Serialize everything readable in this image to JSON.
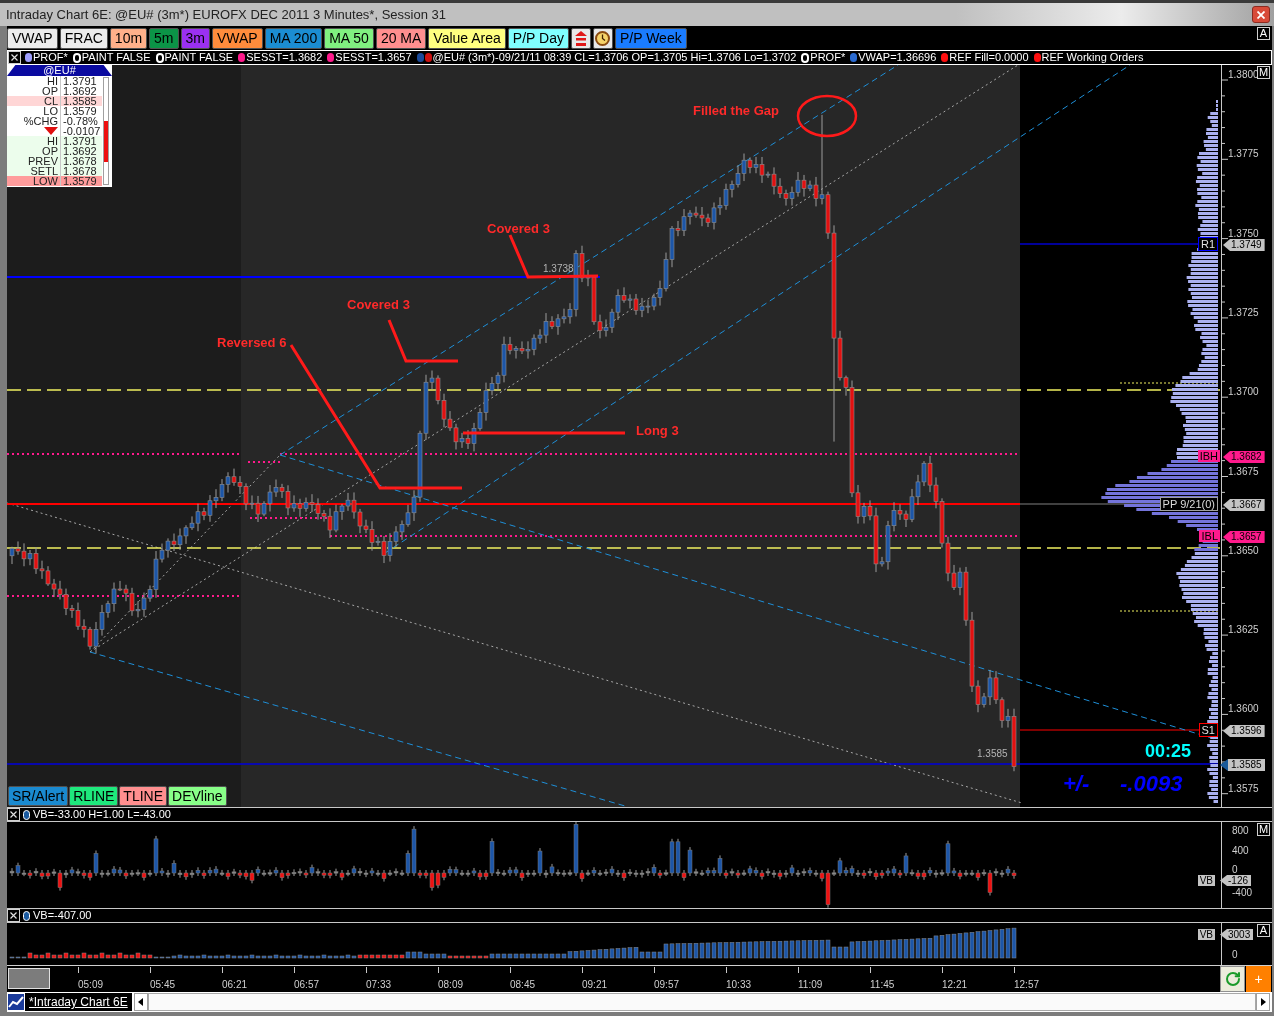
{
  "window": {
    "title": "Intraday Chart 6E: @EU# (3m*) EUROFX DEC 2011 3 Minutes*, Session 31"
  },
  "toolbar": {
    "buttons": [
      {
        "kind": "text",
        "label": "VWAP",
        "color": "#ececec"
      },
      {
        "kind": "text",
        "label": "FRAC",
        "color": "#ececec"
      },
      {
        "kind": "text",
        "label": "10m",
        "color": "#ffb08a"
      },
      {
        "kind": "text",
        "label": "5m",
        "color": "#0b9447"
      },
      {
        "kind": "text",
        "label": "3m",
        "color": "#9b30f2"
      },
      {
        "kind": "text",
        "label": "VWAP",
        "color": "#ff8c3c"
      },
      {
        "kind": "text",
        "label": "MA 200",
        "color": "#1b8dd2"
      },
      {
        "kind": "text",
        "label": "MA 50",
        "color": "#80f080"
      },
      {
        "kind": "text",
        "label": "20 MA",
        "color": "#ff8f8f"
      },
      {
        "kind": "text",
        "label": "Value Area",
        "color": "#ffff80"
      },
      {
        "kind": "text",
        "label": "P/P Day",
        "color": "#80ffff"
      },
      {
        "kind": "alert",
        "color": "#e8e8e8"
      },
      {
        "kind": "clock",
        "color": "#e8e8e8"
      },
      {
        "kind": "text",
        "label": "P/P Week",
        "color": "#1a7cff"
      }
    ],
    "corner_label": "A"
  },
  "legend": {
    "items": [
      {
        "dots": [
          {
            "color": "#a0a0ff",
            "hollow": false
          }
        ],
        "text": "PROF*"
      },
      {
        "dots": [
          {
            "hollow": true
          }
        ],
        "text": "PAINT FALSE"
      },
      {
        "dots": [
          {
            "hollow": true
          }
        ],
        "text": "PAINT FALSE"
      },
      {
        "dots": [
          {
            "color": "#ff1a8c",
            "hollow": false
          }
        ],
        "text": "SESST=1.3682"
      },
      {
        "dots": [
          {
            "color": "#ff1a8c",
            "hollow": false
          }
        ],
        "text": "SESST=1.3657"
      },
      {
        "dots": [
          {
            "color": "#1a4a9a",
            "hollow": false
          },
          {
            "color": "#cc1111",
            "hollow": false
          }
        ],
        "text": "@EU# (3m*)-09/21/11 08:39 CL=1.3706 OP=1.3705 Hi=1.3706 Lo=1.3702"
      },
      {
        "dots": [
          {
            "hollow": true
          }
        ],
        "text": "PROF*"
      },
      {
        "dots": [
          {
            "color": "#2a6ad0",
            "hollow": false
          }
        ],
        "text": "VWAP=1.36696"
      },
      {
        "dots": [
          {
            "color": "#ff1010",
            "hollow": false
          }
        ],
        "text": "REF Fill=0.0000"
      },
      {
        "dots": [
          {
            "color": "#ff1010",
            "hollow": false
          }
        ],
        "text": "REF Working Orders"
      }
    ]
  },
  "quote_box": {
    "symbol": "@EU#",
    "rows": [
      {
        "kind": "value",
        "label": "HI",
        "value": "1.3791",
        "color": "#ffffff"
      },
      {
        "kind": "value",
        "label": "OP",
        "value": "1.3692",
        "color": "#ffffff"
      },
      {
        "kind": "value",
        "label": "CL",
        "value": "1.3585",
        "color": "#ffd6d6"
      },
      {
        "kind": "value",
        "label": "LO",
        "value": "1.3579",
        "color": "#ffffff"
      },
      {
        "kind": "value",
        "label": "%CHG",
        "value": "-0.78%",
        "color": "#ffffff"
      },
      {
        "kind": "change",
        "falling": true,
        "value": "-0.0107",
        "color": "#ffffff"
      },
      {
        "kind": "value",
        "label": "HI",
        "value": "1.3791",
        "color": "#ecfdec"
      },
      {
        "kind": "value",
        "label": "OP",
        "value": "1.3692",
        "color": "#ecfdec"
      },
      {
        "kind": "value",
        "label": "PREV",
        "value": "1.3678",
        "color": "#ecfdec"
      },
      {
        "kind": "value",
        "label": "SETL",
        "value": "1.3678",
        "color": "#ecfdec"
      },
      {
        "kind": "value",
        "label": "LOW",
        "value": "1.3579",
        "color": "#ff9c9c"
      }
    ],
    "range_bar": {
      "level": 0.39
    }
  },
  "chart": {
    "annotations": [
      "Filled the Gap",
      "Covered 3",
      "Covered 3",
      "Reversed 6",
      "Long 3"
    ],
    "price_notes": [
      "1.3738",
      "1.3585"
    ],
    "countdown": "00:25",
    "change": {
      "label": "+/-",
      "value": "-.0093"
    },
    "tool_buttons": [
      {
        "label": "SR/Alert",
        "color": "#1a8ad0"
      },
      {
        "label": "RLINE",
        "color": "#1ee87c"
      },
      {
        "label": "TLINE",
        "color": "#ff8f8f"
      },
      {
        "label": "DEVline",
        "color": "#88ff88"
      }
    ]
  },
  "price_axis": {
    "corner_label": "M",
    "ticks": [
      "1.3800",
      "1.3775",
      "1.3750",
      "1.3725",
      "1.3700",
      "1.3675",
      "1.3650",
      "1.3625",
      "1.3600",
      "1.3575"
    ],
    "markers": [
      {
        "kind": "outlined",
        "label": "R1",
        "value": "1.3749",
        "color": "#0000ff"
      },
      {
        "kind": "filled",
        "label": "IBH",
        "value": "1.3682",
        "color": "#ff1a8c"
      },
      {
        "kind": "boxed",
        "label": "PP 9/21(0)",
        "value": "1.3667",
        "color": "#a0a0a0"
      },
      {
        "kind": "filled",
        "label": "IBL",
        "value": "1.3657",
        "color": "#ff1a8c"
      },
      {
        "kind": "outlined",
        "label": "S1",
        "value": "1.3596",
        "color": "#ff0000"
      },
      {
        "kind": "last",
        "value": "1.3585",
        "color": "#1a5a9a"
      }
    ]
  },
  "panels": [
    {
      "legend": "VB=-33.00 H=1.00 L=-43.00",
      "ticks": [
        "800",
        "400",
        "0",
        "-400"
      ],
      "tag": {
        "label": "VB",
        "value": "-126"
      },
      "corner_label": "M"
    },
    {
      "legend": "VB=-407.00",
      "ticks": [
        "0"
      ],
      "tag": {
        "label": "VB",
        "value": "3003"
      },
      "corner_label": "A"
    }
  ],
  "time_axis": {
    "labels": [
      "05:09",
      "05:45",
      "06:21",
      "06:57",
      "07:33",
      "08:09",
      "08:45",
      "09:21",
      "09:57",
      "10:33",
      "11:09",
      "11:45",
      "12:21",
      "12:57"
    ],
    "add_label": "+"
  },
  "status_bar": {
    "tabs": [
      {
        "label": "*Intraday Chart 6E",
        "selected": true
      }
    ]
  }
}
